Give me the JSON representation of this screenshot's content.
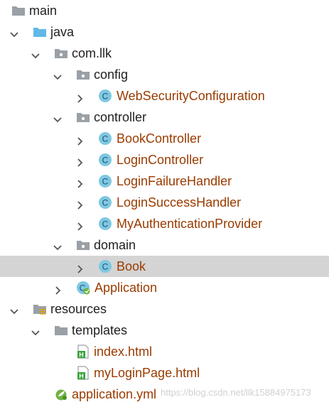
{
  "tree": [
    {
      "label": "main",
      "icon": "folder-icon",
      "expanded": null
    },
    {
      "label": "java",
      "icon": "source-folder-icon",
      "expanded": true
    },
    {
      "label": "com.llk",
      "icon": "package-icon",
      "expanded": true
    },
    {
      "label": "config",
      "icon": "package-icon",
      "expanded": true
    },
    {
      "label": "WebSecurityConfiguration",
      "icon": "class-icon",
      "expanded": false
    },
    {
      "label": "controller",
      "icon": "package-icon",
      "expanded": true
    },
    {
      "label": "BookController",
      "icon": "class-icon",
      "expanded": false
    },
    {
      "label": "LoginController",
      "icon": "class-icon",
      "expanded": false
    },
    {
      "label": "LoginFailureHandler",
      "icon": "class-icon",
      "expanded": false
    },
    {
      "label": "LoginSuccessHandler",
      "icon": "class-icon",
      "expanded": false
    },
    {
      "label": "MyAuthenticationProvider",
      "icon": "class-icon",
      "expanded": false
    },
    {
      "label": "domain",
      "icon": "package-icon",
      "expanded": true
    },
    {
      "label": "Book",
      "icon": "class-icon",
      "expanded": false,
      "selected": true
    },
    {
      "label": "Application",
      "icon": "spring-boot-class-icon",
      "expanded": false
    },
    {
      "label": "resources",
      "icon": "resources-folder-icon",
      "expanded": true
    },
    {
      "label": "templates",
      "icon": "folder-icon",
      "expanded": true
    },
    {
      "label": "index.html",
      "icon": "html-file-icon",
      "expanded": null
    },
    {
      "label": "myLoginPage.html",
      "icon": "html-file-icon",
      "expanded": null
    },
    {
      "label": "application.yml",
      "icon": "yml-file-icon",
      "expanded": null
    }
  ],
  "watermark": "https://blog.csdn.net/llk15884975173",
  "colors": {
    "class_label": "#9a3b00",
    "class_icon_fill": "#7ec8e3",
    "selection_bg": "#d4d4d4",
    "folder_gray": "#9aa0a6",
    "folder_blue": "#62b8e6"
  }
}
